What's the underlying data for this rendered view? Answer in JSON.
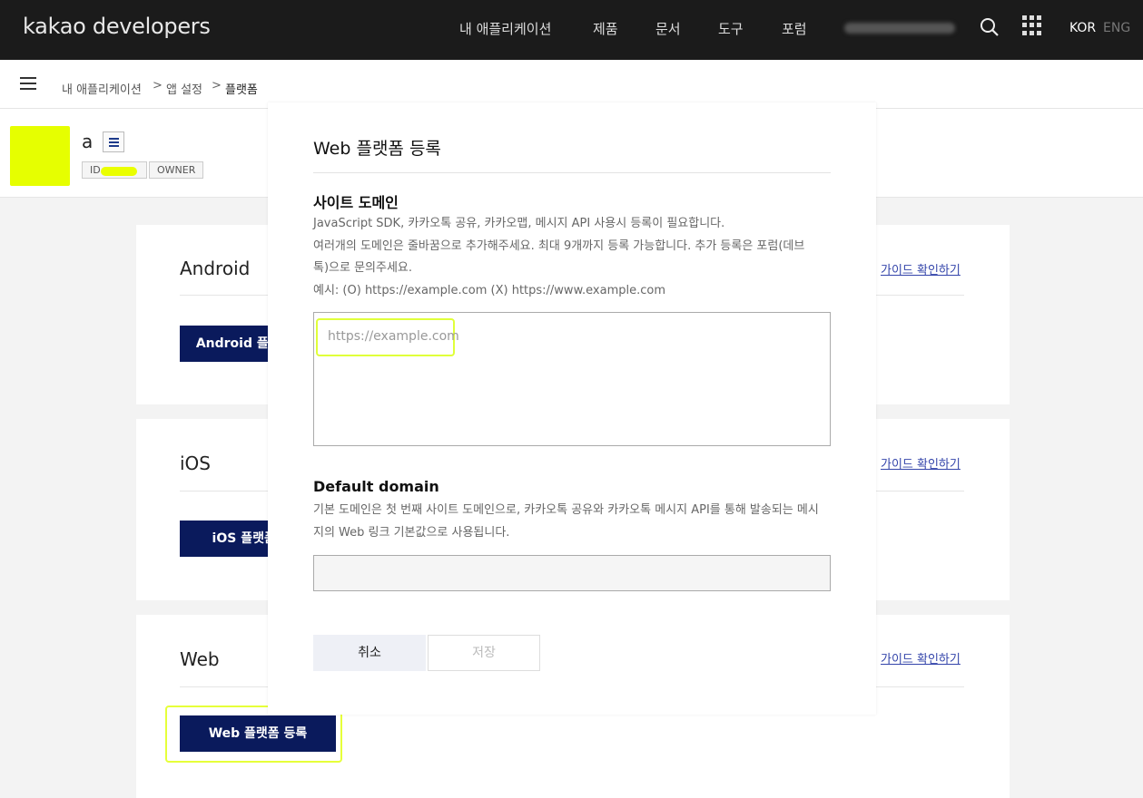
{
  "header": {
    "logo": "kakao developers",
    "nav": [
      "내 애플리케이션",
      "제품",
      "문서",
      "도구",
      "포럼"
    ],
    "lang_active": "KOR",
    "lang_inactive": "ENG"
  },
  "breadcrumb": [
    "내 애플리케이션",
    "앱 설정",
    "플랫폼"
  ],
  "app": {
    "name": "a",
    "id_label": "ID",
    "role": "OWNER",
    "icon_color": "#e6ff00"
  },
  "sections": [
    {
      "title": "Android",
      "button": "Android 플랫폼 등록",
      "guide": "가이드 확인하기"
    },
    {
      "title": "iOS",
      "button": "iOS 플랫폼 등록",
      "guide": "가이드 확인하기"
    },
    {
      "title": "Web",
      "button": "Web 플랫폼 등록",
      "guide": "가이드 확인하기"
    }
  ],
  "modal": {
    "title": "Web 플랫폼 등록",
    "site_domain": {
      "title": "사이트 도메인",
      "help": [
        "JavaScript SDK, 카카오톡 공유, 카카오맵, 메시지 API 사용시 등록이 필요합니다.",
        "여러개의 도메인은 줄바꿈으로 추가해주세요. 최대 9개까지 등록 가능합니다. 추가 등록은 포럼(데브",
        "톡)으로 문의주세요.",
        "예시: (O) https://example.com (X) https://www.example.com"
      ],
      "placeholder": "https://example.com",
      "value": ""
    },
    "default_domain": {
      "title": "Default domain",
      "help": [
        "기본 도메인은 첫 번째 사이트 도메인으로, 카카오톡 공유와 카카오톡 메시지 API를 통해 발송되는 메시",
        "지의 Web 링크 기본값으로 사용됩니다."
      ],
      "value": ""
    },
    "cancel_label": "취소",
    "save_label": "저장"
  },
  "colors": {
    "header_bg": "#1b1b1b",
    "primary_button": "#0a1a5c",
    "highlight": "#e6ff3a"
  }
}
